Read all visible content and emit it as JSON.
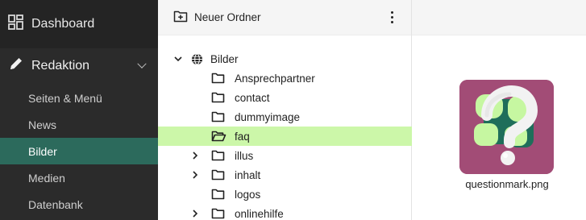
{
  "sidebar": {
    "top": {
      "label": "Dashboard",
      "icon": "dashboard-icon"
    },
    "section": {
      "label": "Redaktion",
      "icon": "pencil-icon"
    },
    "items": [
      {
        "label": "Seiten & Menü"
      },
      {
        "label": "News"
      },
      {
        "label": "Bilder",
        "active": true
      },
      {
        "label": "Medien"
      },
      {
        "label": "Datenbank"
      }
    ]
  },
  "toolbar": {
    "new_folder_label": "Neuer Ordner",
    "new_folder_icon": "folder-plus-icon",
    "menu_icon": "more-vertical-icon"
  },
  "tree": {
    "root": {
      "label": "Bilder",
      "icon": "globe-icon",
      "expanded": true
    },
    "folders": [
      {
        "label": "Ansprechpartner",
        "has_children": false
      },
      {
        "label": "contact",
        "has_children": false
      },
      {
        "label": "dummyimage",
        "has_children": false
      },
      {
        "label": "faq",
        "has_children": false,
        "selected": true,
        "open": true
      },
      {
        "label": "illus",
        "has_children": true
      },
      {
        "label": "inhalt",
        "has_children": true
      },
      {
        "label": "logos",
        "has_children": false
      },
      {
        "label": "onlinehilfe",
        "has_children": true
      }
    ]
  },
  "preview": {
    "file_name": "questionmark.png",
    "colors": {
      "background": "#a24c76",
      "green_light": "#c6f7a1",
      "green_dark": "#1f6e5a"
    }
  },
  "colors": {
    "sidebar_bg": "#2b2b2b",
    "sidebar_active": "#2c6a5c",
    "tree_highlight": "#ccf7a9"
  }
}
